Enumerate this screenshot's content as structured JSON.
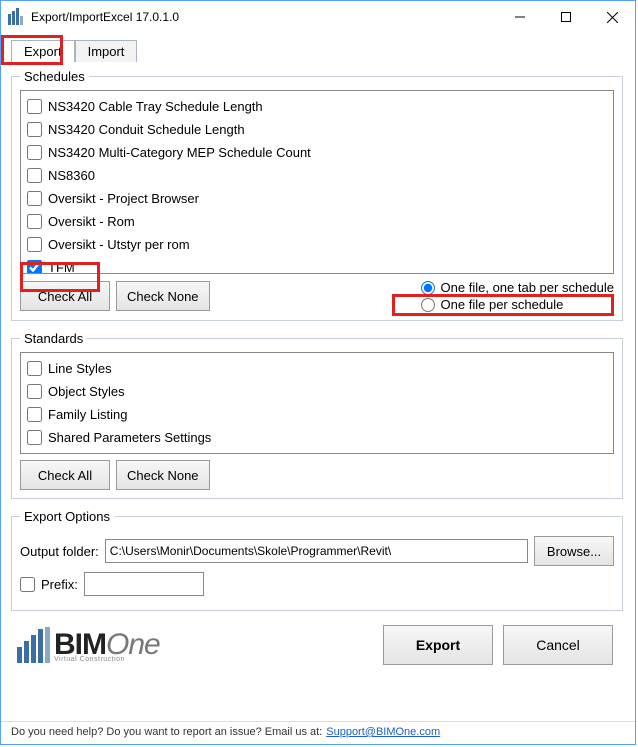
{
  "window_title": "Export/ImportExcel 17.0.1.0",
  "tabs": {
    "export": "Export",
    "import": "Import",
    "active": "export"
  },
  "schedules": {
    "legend": "Schedules",
    "items": [
      {
        "label": "NS3420 Cable Tray Schedule Length",
        "checked": false
      },
      {
        "label": "NS3420 Conduit Schedule Length",
        "checked": false
      },
      {
        "label": "NS3420 Multi-Category MEP Schedule Count",
        "checked": false
      },
      {
        "label": "NS8360",
        "checked": false
      },
      {
        "label": "Oversikt - Project Browser",
        "checked": false
      },
      {
        "label": "Oversikt - Rom",
        "checked": false
      },
      {
        "label": "Oversikt - Utstyr per rom",
        "checked": false
      },
      {
        "label": "TFM",
        "checked": true
      }
    ],
    "check_all": "Check All",
    "check_none": "Check None",
    "file_option_1": "One file, one tab per schedule",
    "file_option_2": "One file per schedule",
    "file_option_selected": 0
  },
  "standards": {
    "legend": "Standards",
    "items": [
      {
        "label": "Line Styles",
        "checked": false
      },
      {
        "label": "Object Styles",
        "checked": false
      },
      {
        "label": "Family Listing",
        "checked": false
      },
      {
        "label": "Shared Parameters Settings",
        "checked": false
      }
    ],
    "check_all": "Check All",
    "check_none": "Check None"
  },
  "export_options": {
    "legend": "Export Options",
    "output_folder_label": "Output folder:",
    "output_folder_value": "C:\\Users\\Monir\\Documents\\Skole\\Programmer\\Revit\\",
    "browse_label": "Browse...",
    "prefix_checkbox": false,
    "prefix_label": "Prefix:",
    "prefix_value": ""
  },
  "footer": {
    "export_btn": "Export",
    "cancel_btn": "Cancel"
  },
  "helpbar": {
    "text": "Do you need help? Do you want to report an issue? Email us at:",
    "link_text": "Support@BIMOne.com"
  },
  "logo": {
    "bim": "BIM",
    "one": "One",
    "sub": "Virtual Construction"
  }
}
